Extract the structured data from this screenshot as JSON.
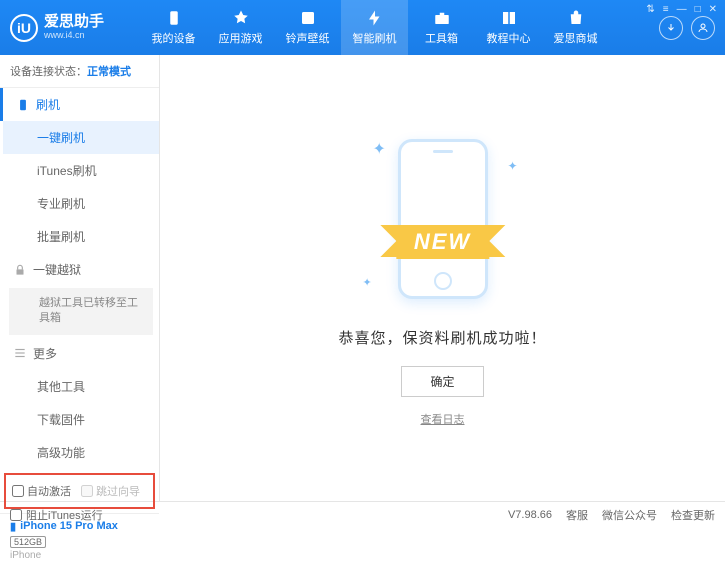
{
  "logo": {
    "badge": "iU",
    "title": "爱思助手",
    "url": "www.i4.cn"
  },
  "nav": {
    "items": [
      {
        "label": "我的设备"
      },
      {
        "label": "应用游戏"
      },
      {
        "label": "铃声壁纸"
      },
      {
        "label": "智能刷机"
      },
      {
        "label": "工具箱"
      },
      {
        "label": "教程中心"
      },
      {
        "label": "爱思商城"
      }
    ]
  },
  "status": {
    "label": "设备连接状态：",
    "mode": "正常模式"
  },
  "sidebar": {
    "flash": {
      "title": "刷机",
      "items": [
        {
          "label": "一键刷机"
        },
        {
          "label": "iTunes刷机"
        },
        {
          "label": "专业刷机"
        },
        {
          "label": "批量刷机"
        }
      ]
    },
    "jailbreak": {
      "title": "一键越狱",
      "note": "越狱工具已转移至工具箱"
    },
    "more": {
      "title": "更多",
      "items": [
        {
          "label": "其他工具"
        },
        {
          "label": "下载固件"
        },
        {
          "label": "高级功能"
        }
      ]
    },
    "checkboxes": {
      "auto_activate": "自动激活",
      "skip_guide": "跳过向导"
    },
    "device": {
      "name": "iPhone 15 Pro Max",
      "storage": "512GB",
      "type": "iPhone"
    }
  },
  "main": {
    "ribbon": "NEW",
    "success_text": "恭喜您，保资料刷机成功啦！",
    "ok_button": "确定",
    "log_link": "查看日志"
  },
  "footer": {
    "block_itunes": "阻止iTunes运行",
    "version": "V7.98.66",
    "links": {
      "support": "客服",
      "wechat": "微信公众号",
      "update": "检查更新"
    }
  }
}
